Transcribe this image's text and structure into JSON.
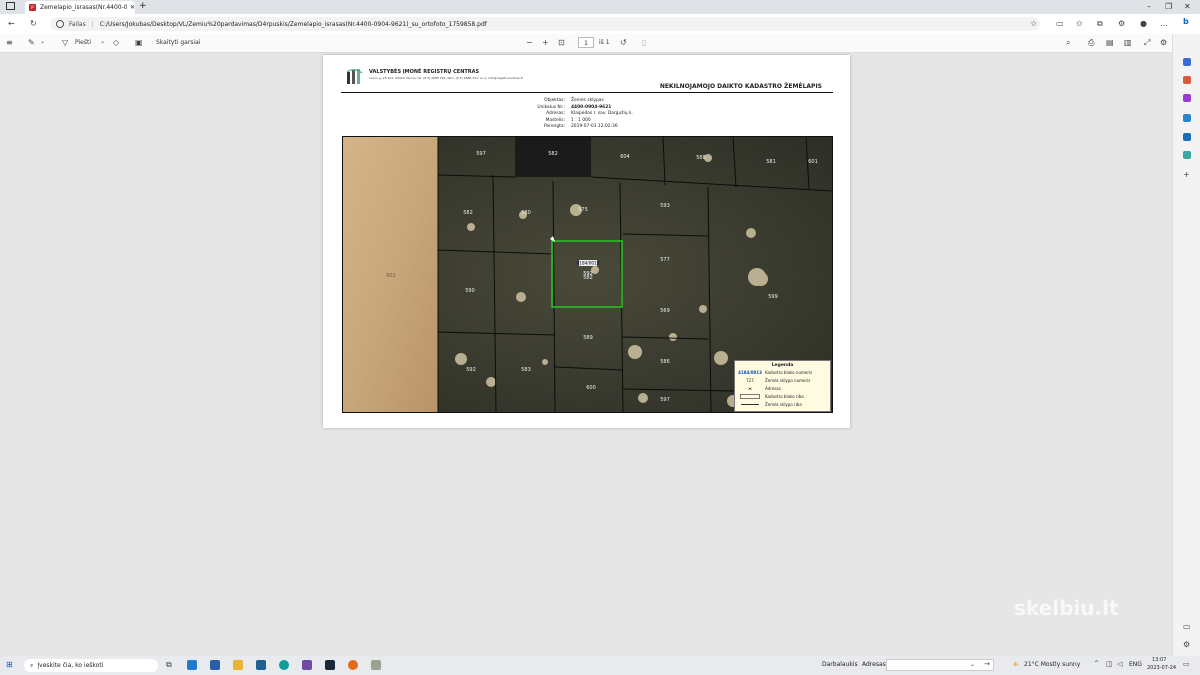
{
  "browser": {
    "tab_title": "Zemelapio_israsas(Nr.4400-0904-9621)_su_ortofoto_1759858.pdf",
    "address_prefix": "Failas",
    "url": "C:/Users/Jokubas/Desktop/VL/Zemiu%20pardavimas/D4rpuskis/Zemelapio_israsas(Nr.4400-0904-9621)_su_ortofoto_1759858.pdf"
  },
  "pdf_toolbar": {
    "draw_label": "Piešti",
    "text_label": "Skaityti garsiai",
    "page_current": "1",
    "page_total": "iš 1"
  },
  "document": {
    "org_name": "VALSTYBĖS ĮMONĖ REGISTRŲ CENTRAS",
    "org_address": "Lvovo g. 25-101, 09320 Vilnius, tel. (8 5) 2688 262, faks. (8 5) 2688 311, el. p. info@registrucentras.lt",
    "title": "NEKILNOJAMOJO DAIKTO KADASTRO ŽEMĖLAPIS",
    "info": [
      {
        "key": "Objektas:",
        "value": "Žemės sklypas"
      },
      {
        "key": "Unikalus Nr.:",
        "value": "4400-0904-9621"
      },
      {
        "key": "Adresas:",
        "value": "Klaipėdos r. sav. Dargužių k."
      },
      {
        "key": "Mastelis:",
        "value": "1 : 1 000"
      },
      {
        "key": "Parengta:",
        "value": "2019-07-03 12:02:36"
      }
    ],
    "parcel_labels": [
      "597",
      "582",
      "604",
      "588",
      "581",
      "601",
      "582",
      "580",
      "575",
      "593",
      "602",
      "590",
      "582",
      "577",
      "599",
      "569",
      "589",
      "592",
      "583",
      "586",
      "600",
      "597",
      "593"
    ],
    "selected_label": "4184/0013",
    "selected_sub": "592",
    "legend": {
      "title": "Legenda",
      "rows": [
        {
          "sym": "4184/0013",
          "label": "Kadastro bloko numeris"
        },
        {
          "sym": "727",
          "label": "Žemės sklypo numeris"
        },
        {
          "sym": "ж",
          "label": "Adresas"
        },
        {
          "sym": "",
          "label": "Kadastro bloko riba"
        },
        {
          "sym": "",
          "label": "Žemės sklypo riba"
        }
      ]
    }
  },
  "taskbar": {
    "search_placeholder": "Įveskite čia, ko ieškoti",
    "desktop_label": "Darbalaukis",
    "address_label": "Adresas",
    "weather": "21°C  Mostly sunny",
    "lang": "ENG",
    "time": "13:07",
    "date": "2023-07-24"
  },
  "watermark": "skelbiu.lt",
  "colors": {
    "accent": "#0078d4",
    "parcel_highlight": "#22c322",
    "pdf_red": "#c4282b"
  }
}
